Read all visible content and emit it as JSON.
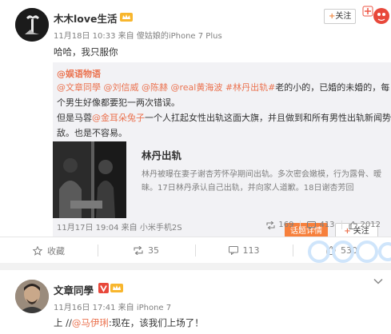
{
  "post1": {
    "username": "木木love生活",
    "meta_date": "11月18日 10:33",
    "meta_from": "来自",
    "meta_device": "傻姑娘的iPhone 7 Plus",
    "follow_label": "关注",
    "text": "哈哈，我只服你"
  },
  "repost": {
    "author": "@娱语物语",
    "line1": {
      "mentions": [
        "@文章同學",
        "@刘信威",
        "@陈赫",
        "@real黄海波",
        "#林丹出轨#"
      ],
      "tail": "老的小的，已婚的未婚的，每"
    },
    "line2": "个男生好像都要犯一两次错误。",
    "line3_pre": "但是马蓉",
    "line3_mention": "@金耳朵兔子",
    "line3_post": "一个人扛起女性出轨这面大旗，并且做到和所有男性出轨新闻势均力",
    "line4": "敌。也是不容易。",
    "card": {
      "title": "林丹出轨",
      "desc": "林丹被曝在妻子谢杏芳怀孕期间出轨。多次密会嫩模，行为露骨、暧昧。17日林丹承认自己出轨，并向家人道歉。18日谢杏芳回",
      "topic_button": "话题详情",
      "follow_button": "关注"
    },
    "footer": {
      "date": "11月17日 19:04",
      "from": "来自",
      "device": "小米手机2S",
      "reposts": "169",
      "comments": "413",
      "likes": "2012"
    }
  },
  "actions": {
    "favorite": "收藏",
    "repost": "35",
    "comment": "113",
    "like": "530"
  },
  "post2": {
    "username": "文章同學",
    "meta_date": "11月16日 17:41",
    "meta_from": "来自",
    "meta_device": "iPhone 7",
    "text_pre": "上 //",
    "mention": "@马伊琍",
    "text_post": ":现在，该我们上场了！"
  },
  "colors": {
    "link": "#eb7350",
    "accent": "#f7803c",
    "vip_yellow": "#f8b62d",
    "meta_gray": "#808080"
  },
  "icons": [
    "verified-badge-icon",
    "vip-crown-icon",
    "repost-icon",
    "comment-icon",
    "like-icon",
    "favorite-icon",
    "chevron-down-icon",
    "plus-icon"
  ]
}
